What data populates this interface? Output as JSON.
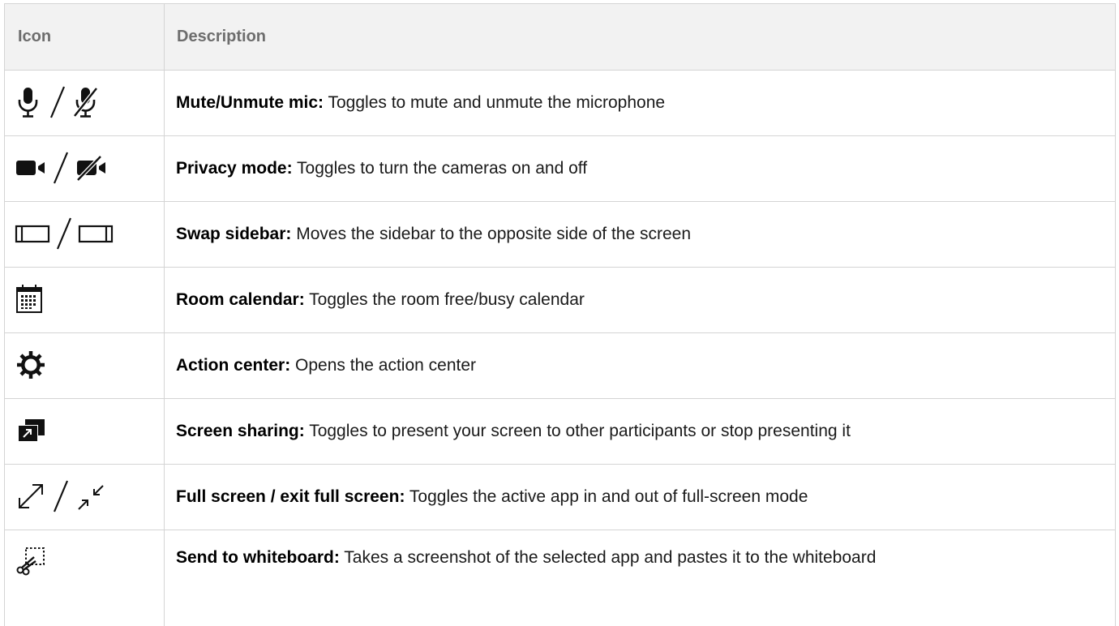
{
  "table": {
    "headers": {
      "icon": "Icon",
      "description": "Description"
    },
    "rows": [
      {
        "icons": [
          "mic-icon",
          "slash-divider",
          "mic-off-icon"
        ],
        "title": "Mute/Unmute mic:",
        "text": "Toggles to mute and unmute the microphone"
      },
      {
        "icons": [
          "camera-icon",
          "slash-divider",
          "camera-off-icon"
        ],
        "title": "Privacy mode:",
        "text": "Toggles to turn the cameras on and off"
      },
      {
        "icons": [
          "sidebar-left-icon",
          "slash-divider",
          "sidebar-right-icon"
        ],
        "title": "Swap sidebar:",
        "text": "Moves the sidebar to the opposite side of the screen"
      },
      {
        "icons": [
          "calendar-icon"
        ],
        "title": "Room calendar:",
        "text": "Toggles the room free/busy calendar"
      },
      {
        "icons": [
          "gear-icon"
        ],
        "title": "Action center:",
        "text": "Opens the action center"
      },
      {
        "icons": [
          "screen-share-icon"
        ],
        "title": "Screen sharing:",
        "text": "Toggles to present your screen to other participants or stop presenting it"
      },
      {
        "icons": [
          "fullscreen-icon",
          "slash-divider",
          "exit-fullscreen-icon"
        ],
        "title": "Full screen / exit full screen:",
        "text": "Toggles the active app in and out of full-screen mode"
      },
      {
        "icons": [
          "snip-icon"
        ],
        "title": "Send to whiteboard:",
        "text": "Takes a screenshot of the selected app and pastes it to the whiteboard"
      }
    ]
  }
}
